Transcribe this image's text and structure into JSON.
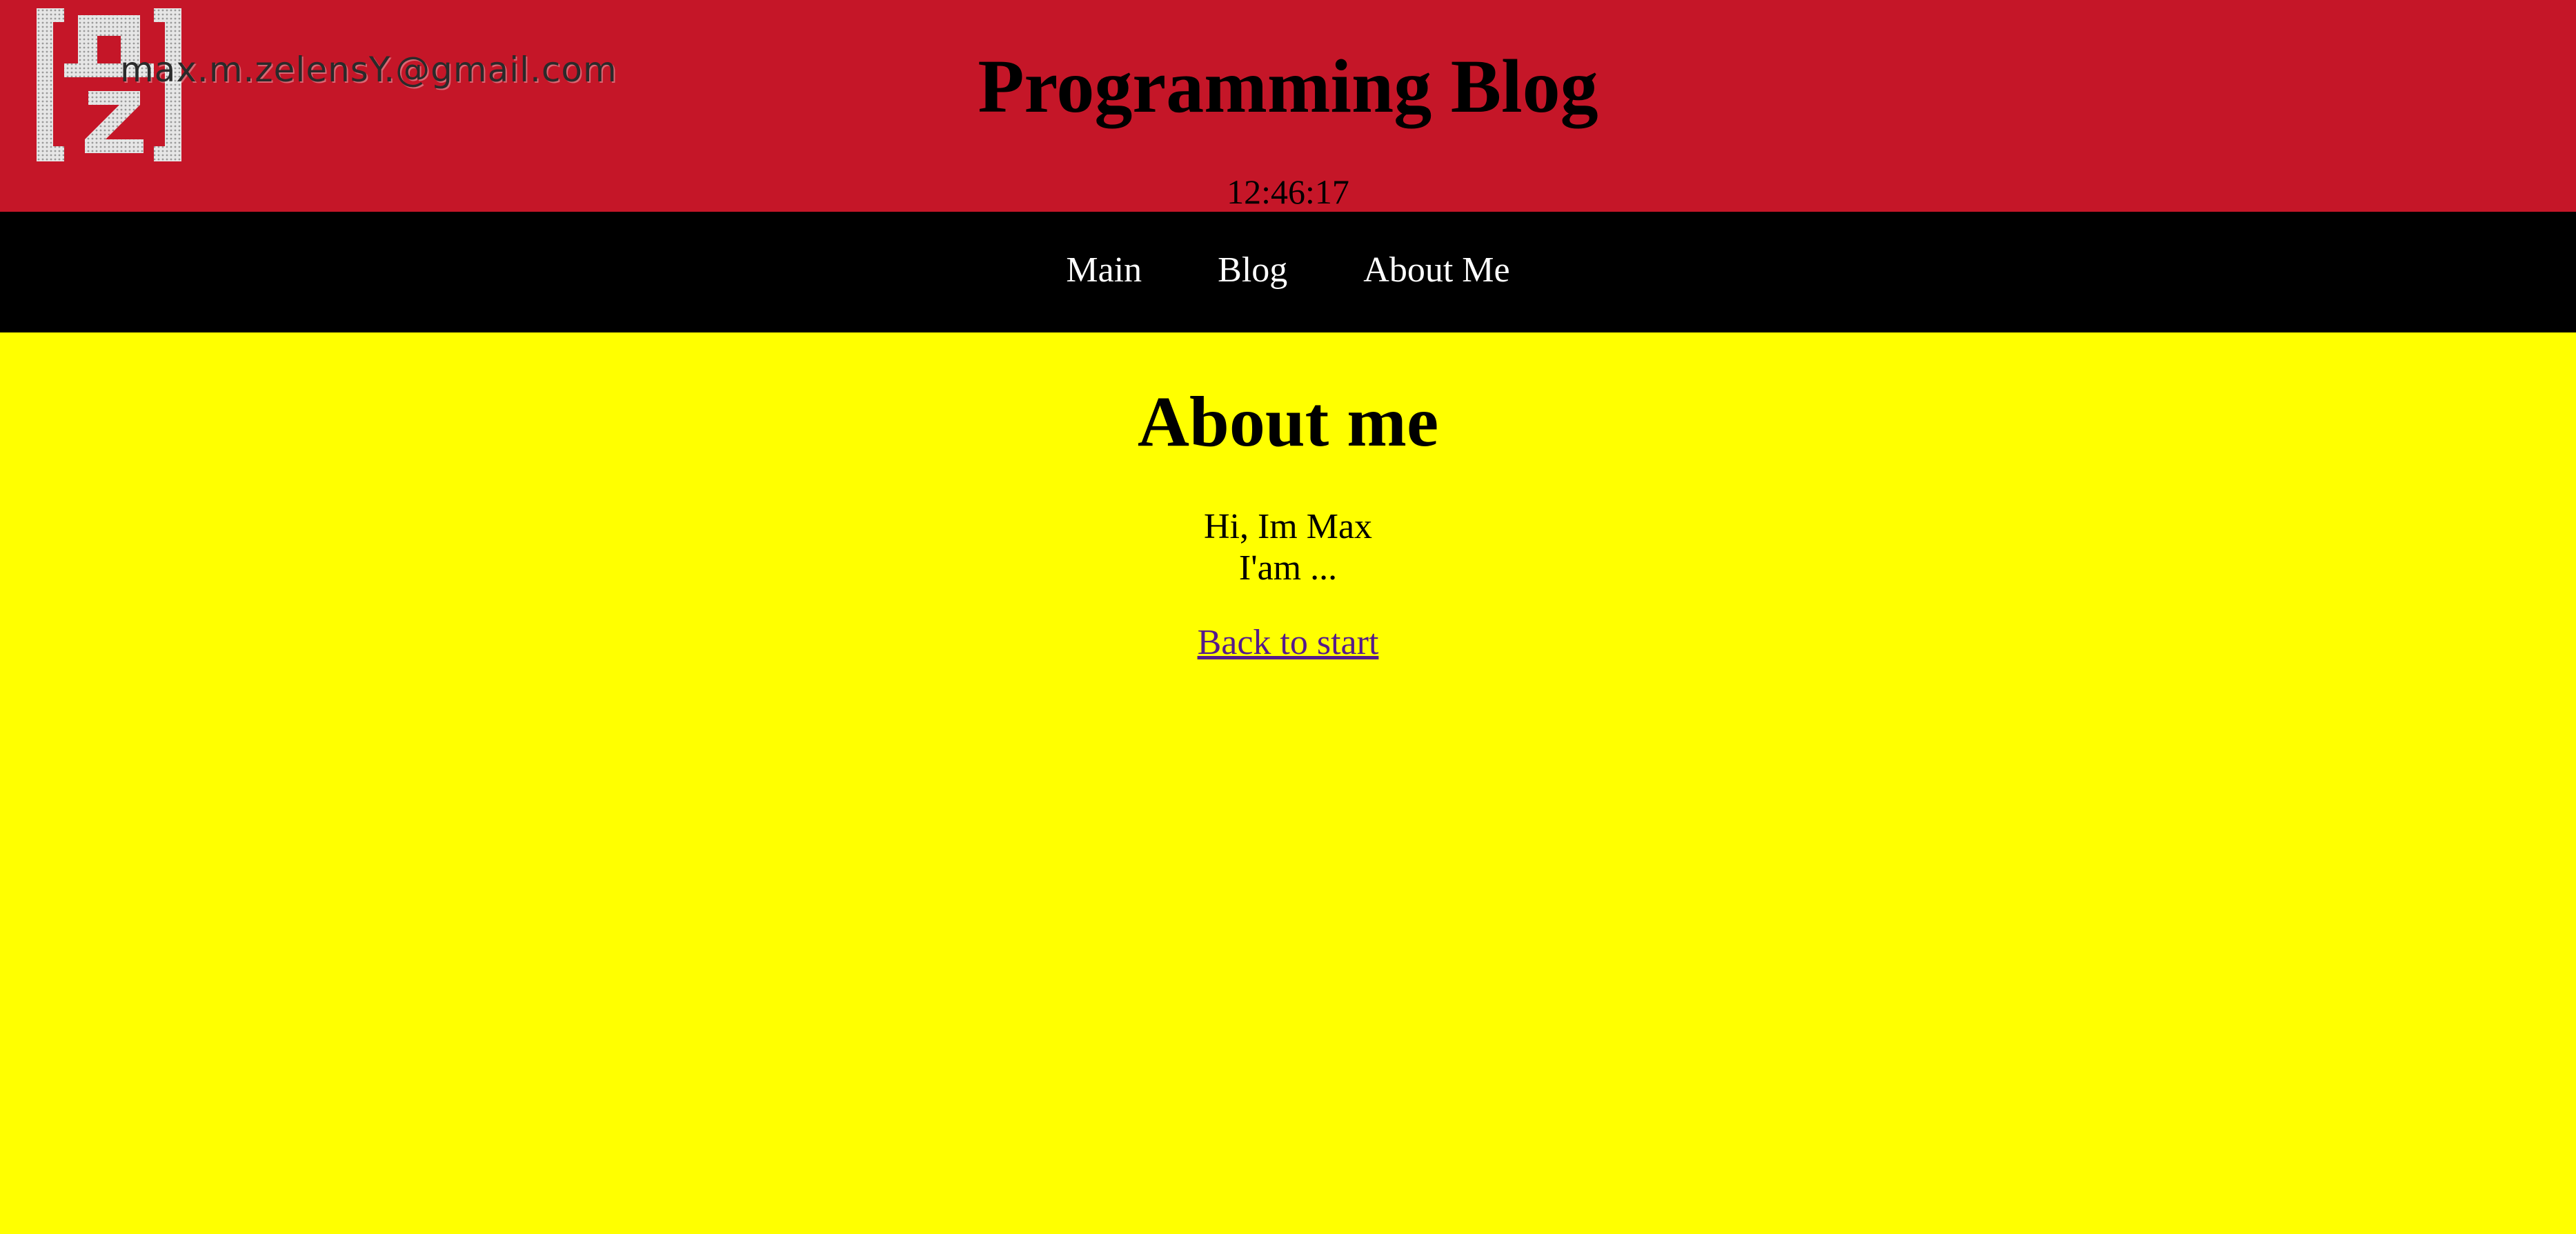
{
  "header": {
    "title": "Programming Blog",
    "time": "12:46:17",
    "email": "max.m.zelensY.@gmail.com",
    "logo_icon": "mz-monogram-logo"
  },
  "nav": {
    "items": [
      {
        "label": "Main"
      },
      {
        "label": "Blog"
      },
      {
        "label": "About Me"
      }
    ]
  },
  "main": {
    "heading": "About me",
    "lines": [
      "Hi, Im Max",
      "I'am ..."
    ],
    "back_link": "Back to start"
  },
  "colors": {
    "header_bg": "#c51628",
    "nav_bg": "#000000",
    "page_bg": "#ffff00",
    "nav_text": "#ffffff",
    "visited_link": "#551a8b"
  }
}
